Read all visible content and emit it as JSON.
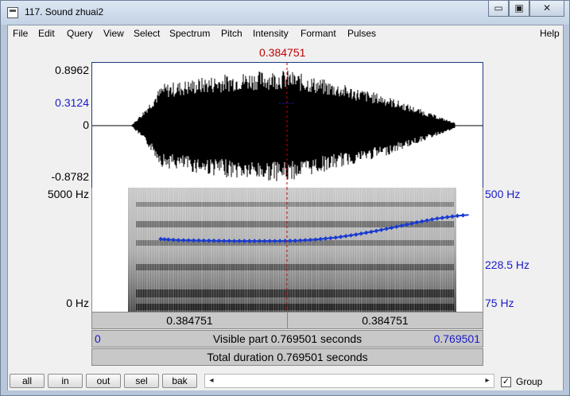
{
  "window": {
    "title": "117. Sound zhuai2",
    "minimize_label": "▭",
    "maximize_label": "▣",
    "close_label": "✕"
  },
  "menu": {
    "items": [
      "File",
      "Edit",
      "Query",
      "View",
      "Select",
      "Spectrum",
      "Pitch",
      "Intensity",
      "Formant",
      "Pulses"
    ],
    "help": "Help"
  },
  "cursor": {
    "time_label": "0.384751",
    "time_s": 0.384751,
    "total_s": 0.769501
  },
  "waveform": {
    "max_label": "0.8962",
    "cursor_value_label": "0.3124",
    "zero_label": "0",
    "min_label": "-0.8782",
    "max_value": 0.8962,
    "min_value": -0.8782,
    "cursor_value": 0.3124
  },
  "spectrogram": {
    "top_label": "5000 Hz",
    "bottom_label": "0 Hz",
    "pitch_top_label": "500 Hz",
    "pitch_mid_label": "228.5 Hz",
    "pitch_bottom_label": "75 Hz",
    "pitch_min_hz": 75,
    "pitch_max_hz": 500
  },
  "pitch_track": [
    [
      0.135,
      228
    ],
    [
      0.15,
      226
    ],
    [
      0.17,
      224
    ],
    [
      0.2,
      223
    ],
    [
      0.24,
      222
    ],
    [
      0.28,
      221
    ],
    [
      0.32,
      221
    ],
    [
      0.36,
      221
    ],
    [
      0.4,
      222
    ],
    [
      0.44,
      226
    ],
    [
      0.48,
      233
    ],
    [
      0.52,
      244
    ],
    [
      0.56,
      258
    ],
    [
      0.6,
      275
    ],
    [
      0.64,
      294
    ],
    [
      0.68,
      312
    ],
    [
      0.72,
      325
    ],
    [
      0.742,
      330
    ]
  ],
  "bars": {
    "cursor_left": "0.384751",
    "cursor_right": "0.384751",
    "visible_start": "0",
    "visible_text": "Visible part 0.769501 seconds",
    "visible_end": "0.769501",
    "total_text": "Total duration 0.769501 seconds"
  },
  "bottom": {
    "buttons": [
      "all",
      "in",
      "out",
      "sel",
      "bak"
    ],
    "scroll_left": "◂",
    "scroll_right": "▸",
    "group_checked": "✓",
    "group_label": "Group"
  }
}
